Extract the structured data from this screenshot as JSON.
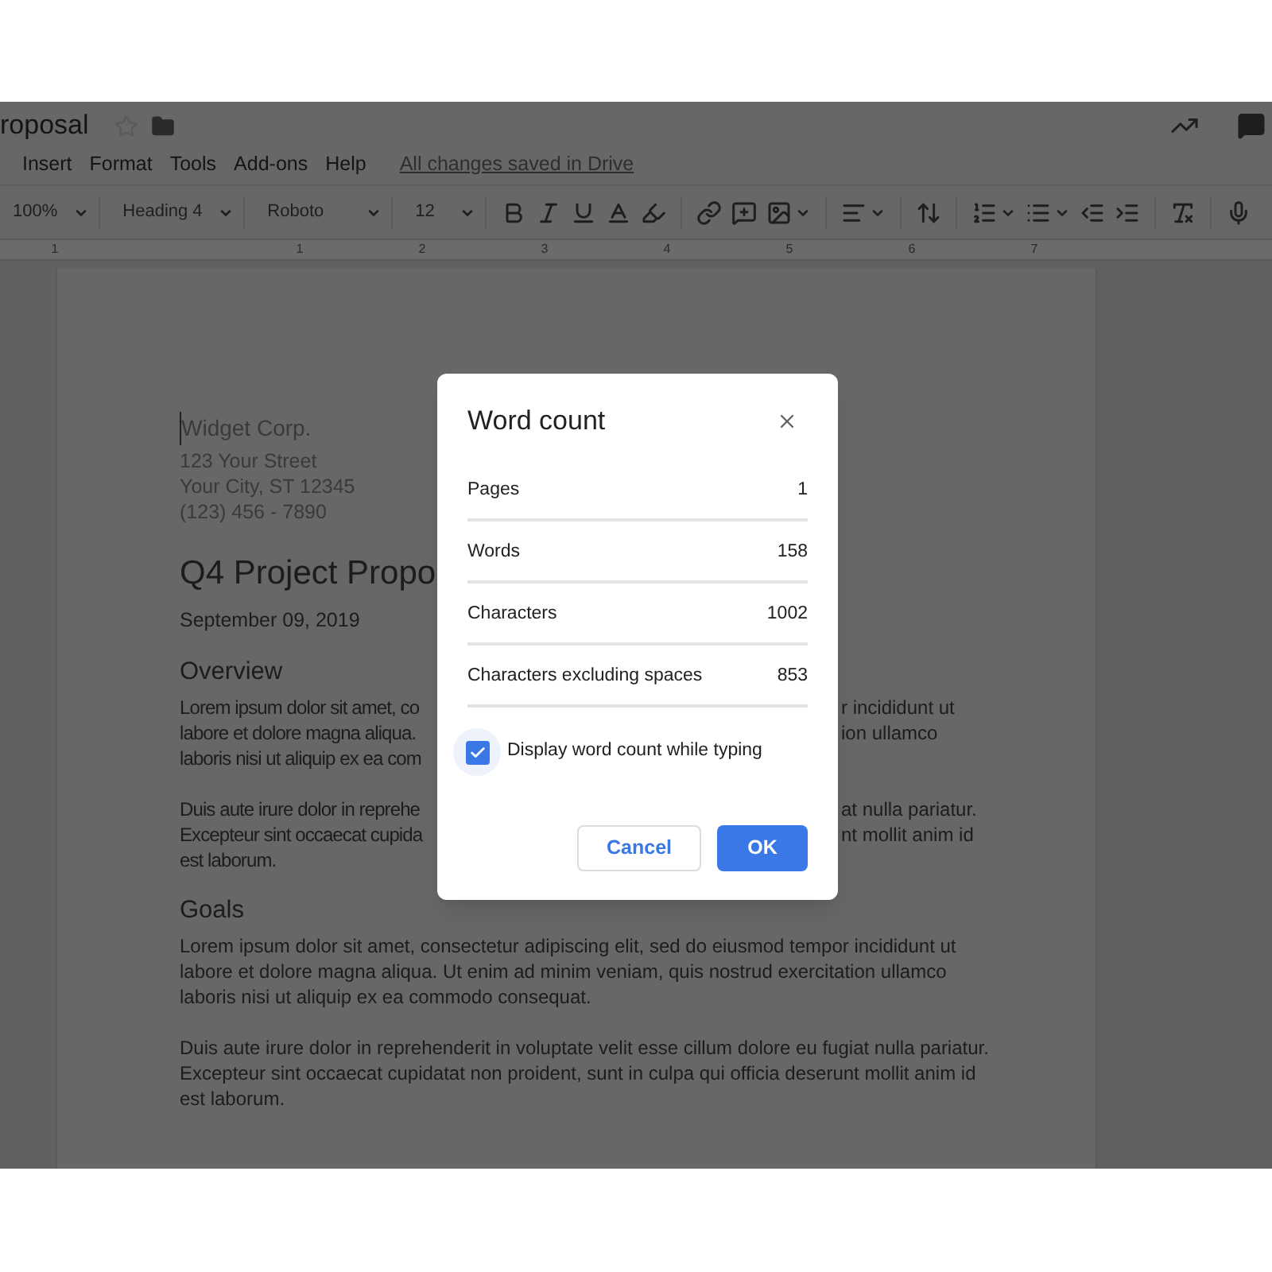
{
  "doc_title": "roposal",
  "menu": [
    "Insert",
    "Format",
    "Tools",
    "Add-ons",
    "Help"
  ],
  "save_status": "All changes saved in Drive",
  "toolbar": {
    "zoom": "100%",
    "style": "Heading 4",
    "font": "Roboto",
    "size": "12"
  },
  "ruler": [
    "1",
    "1",
    "2",
    "3",
    "4",
    "5",
    "6",
    "7"
  ],
  "document": {
    "company": "Widget Corp.",
    "address_lines": [
      "123 Your Street",
      "Your City, ST 12345",
      "(123) 456 - 7890"
    ],
    "title": "Q4 Project Propo",
    "date": "September 09, 2019",
    "sections": [
      {
        "heading": "Overview",
        "paragraphs": [
          [
            {
              "text": "Lorem ipsum dolor sit amet, co",
              "text_after_dialog": "r incididunt ut"
            },
            {
              "text": "labore et dolore magna aliqua.",
              "text_after_dialog": "ion ullamco"
            },
            {
              "text": "laboris nisi ut aliquip ex ea com"
            }
          ],
          [
            {
              "text": "Duis aute irure dolor in reprehe",
              "text_after_dialog": "at nulla pariatur."
            },
            {
              "text": "Excepteur sint occaecat cupida",
              "text_after_dialog": "nt mollit anim id"
            },
            {
              "text": "est laborum."
            }
          ]
        ]
      },
      {
        "heading": "Goals",
        "paragraphs": [
          [
            {
              "text": "Lorem ipsum dolor sit amet, consectetur adipiscing elit, sed do eiusmod tempor incididunt ut"
            },
            {
              "text": "labore et dolore magna aliqua. Ut enim ad minim veniam, quis nostrud exercitation ullamco"
            },
            {
              "text": "laboris nisi ut aliquip ex ea commodo consequat."
            }
          ],
          [
            {
              "text": "Duis aute irure dolor in reprehenderit in voluptate velit esse cillum dolore eu fugiat nulla pariatur."
            },
            {
              "text": "Excepteur sint occaecat cupidatat non proident, sunt in culpa qui officia deserunt mollit anim id"
            },
            {
              "text": "est laborum."
            }
          ]
        ]
      }
    ]
  },
  "dialog": {
    "title": "Word count",
    "rows": [
      {
        "label": "Pages",
        "value": "1"
      },
      {
        "label": "Words",
        "value": "158"
      },
      {
        "label": "Characters",
        "value": "1002"
      },
      {
        "label": "Characters excluding spaces",
        "value": "853"
      }
    ],
    "checkbox": {
      "label": "Display word count while typing",
      "checked": true
    },
    "buttons": [
      {
        "label": "Cancel",
        "kind": "secondary"
      },
      {
        "label": "OK",
        "kind": "primary"
      }
    ]
  }
}
